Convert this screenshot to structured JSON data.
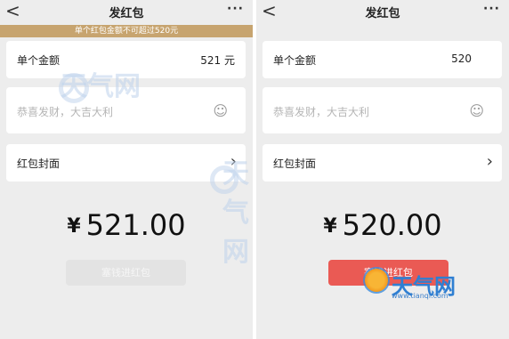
{
  "left": {
    "nav": {
      "back": "<",
      "title": "发红包",
      "more": "···"
    },
    "warning": "单个红包金额不可超过520元",
    "amount_label": "单个金额",
    "amount_value": "521  元",
    "message_placeholder": "恭喜发财，大吉大利",
    "emoji_icon": "☺",
    "cover_label": "红包封面",
    "chevron": "›",
    "yen": "¥",
    "big_amount": "521.00",
    "send_button": "塞钱进红包",
    "send_enabled": false
  },
  "right": {
    "nav": {
      "back": "<",
      "title": "发红包",
      "more": "···"
    },
    "amount_label": "单个金额",
    "amount_value": "520",
    "message_placeholder": "恭喜发财，大吉大利",
    "emoji_icon": "☺",
    "cover_label": "红包封面",
    "chevron": "›",
    "yen": "¥",
    "big_amount": "520.00",
    "send_button": "塞钱进红包",
    "send_enabled": true
  },
  "watermark": {
    "text": "天气网",
    "url": "www.tianqi.com"
  },
  "colors": {
    "warning_bg": "#c7a46f",
    "send_active": "#ea5a54",
    "send_disabled": "#e3e3e3",
    "page_bg": "#ededed"
  }
}
